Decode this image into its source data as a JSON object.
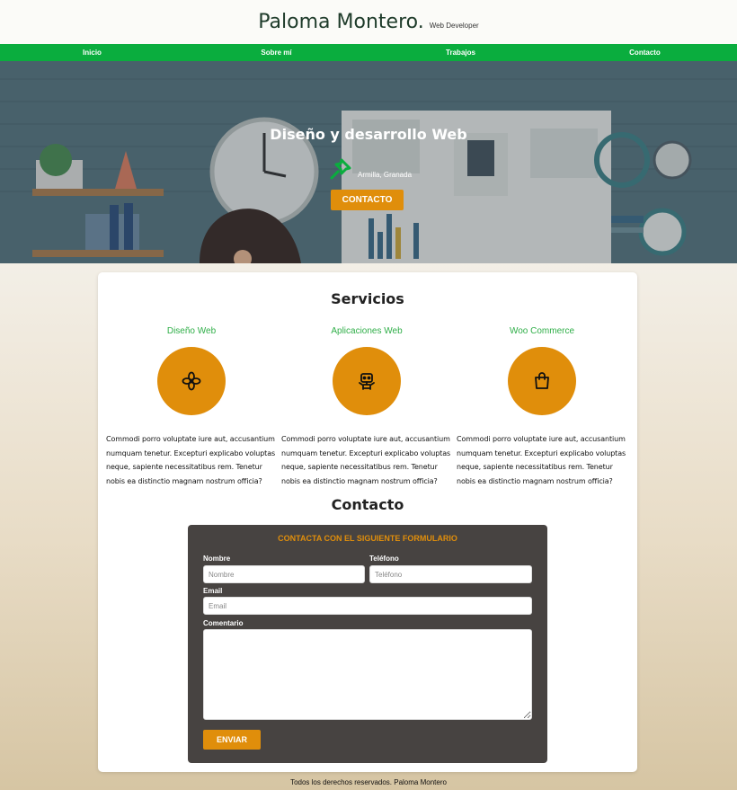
{
  "header": {
    "name": "Paloma Montero.",
    "role": "Web Developer"
  },
  "nav": {
    "items": [
      "Inicio",
      "Sobre mí",
      "Trabajos",
      "Contacto"
    ]
  },
  "hero": {
    "title": "Diseño y desarrollo Web",
    "location": "Armilla, Granada",
    "cta_label": "CONTACTO"
  },
  "services": {
    "title": "Servicios",
    "items": [
      {
        "title": "Diseño Web",
        "icon": "flower-icon",
        "text": "Commodi porro voluptate iure aut, accusantium numquam tenetur. Excepturi explicabo voluptas neque, sapiente necessitatibus rem. Tenetur nobis ea distinctio magnam nostrum officia?"
      },
      {
        "title": "Aplicaciones Web",
        "icon": "robot-icon",
        "text": "Commodi porro voluptate iure aut, accusantium numquam tenetur. Excepturi explicabo voluptas neque, sapiente necessitatibus rem. Tenetur nobis ea distinctio magnam nostrum officia?"
      },
      {
        "title": "Woo Commerce",
        "icon": "shopping-bag-icon",
        "text": "Commodi porro voluptate iure aut, accusantium numquam tenetur. Excepturi explicabo voluptas neque, sapiente necessitatibus rem. Tenetur nobis ea distinctio magnam nostrum officia?"
      }
    ]
  },
  "contact": {
    "title": "Contacto",
    "form_heading": "CONTACTA CON EL SIGUIENTE FORMULARIO",
    "name_label": "Nombre",
    "name_placeholder": "Nombre",
    "phone_label": "Teléfono",
    "phone_placeholder": "Teléfono",
    "email_label": "Email",
    "email_placeholder": "Email",
    "comment_label": "Comentario",
    "submit_label": "ENVIAR"
  },
  "footer": {
    "text": "Todos los derechos reservados. Paloma Montero"
  },
  "colors": {
    "accent": "#e08e0b",
    "nav": "#0aad3e",
    "service_title": "#2fae48",
    "form_bg": "#474341"
  }
}
